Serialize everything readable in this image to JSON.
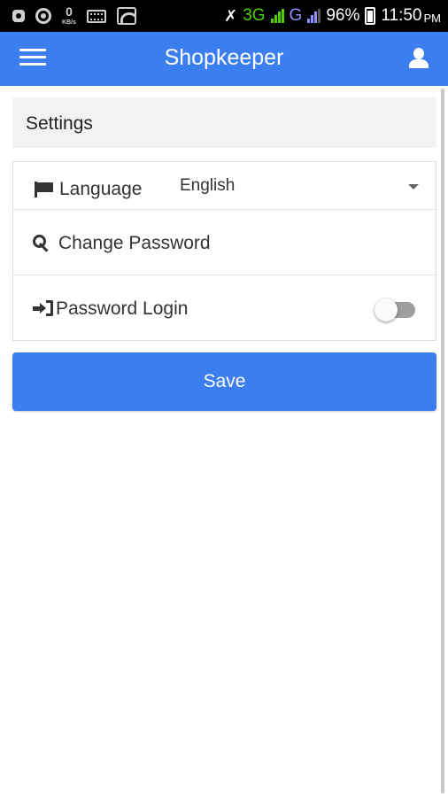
{
  "status_bar": {
    "kbs_value": "0",
    "kbs_unit": "KB/s",
    "network_3g": "3G",
    "network_g": "G",
    "battery": "96%",
    "time": "11:50",
    "time_suffix": "PM"
  },
  "app_bar": {
    "title": "Shopkeeper",
    "menu_icon": "hamburger-menu-icon",
    "user_icon": "user-icon"
  },
  "settings": {
    "header": "Settings",
    "language": {
      "label": "Language",
      "icon": "flag-icon",
      "selected": "English"
    },
    "change_password": {
      "label": "Change Password",
      "icon": "key-icon"
    },
    "password_login": {
      "label": "Password Login",
      "icon": "sign-in-icon",
      "enabled": false
    },
    "save_label": "Save"
  },
  "colors": {
    "primary": "#3a7ef0",
    "header_bg": "#f2f2f2",
    "toggle_off": "#9e9e9e"
  }
}
